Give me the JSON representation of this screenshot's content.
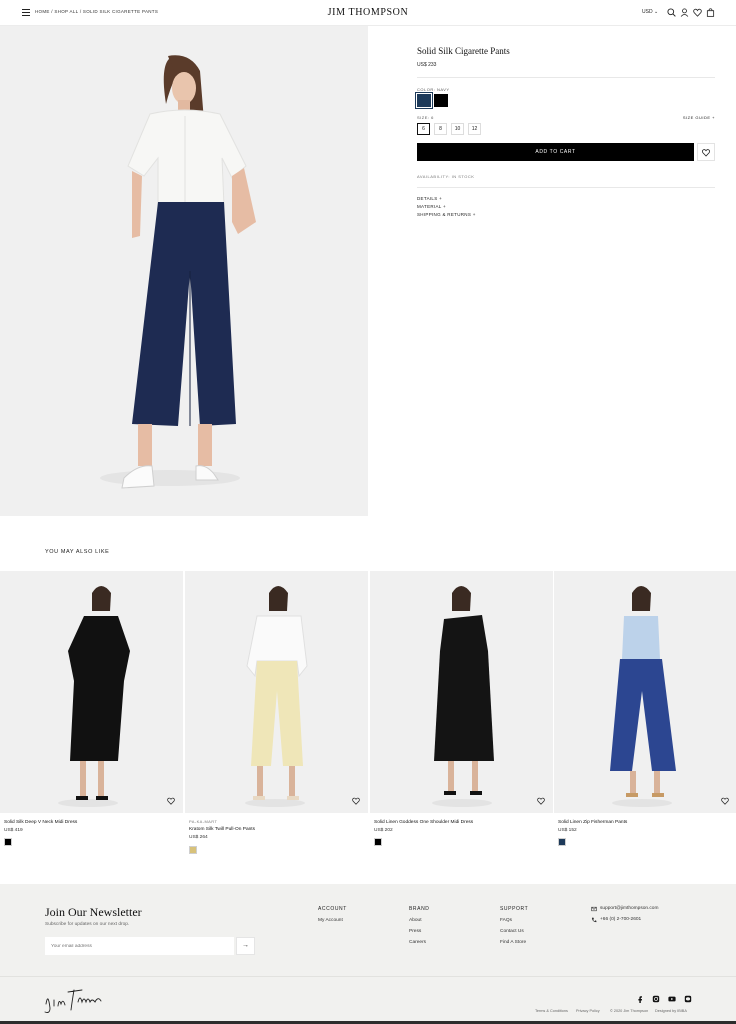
{
  "header": {
    "breadcrumb": "HOME / SHOP ALL / SOLID SILK CIGARETTE PANTS",
    "brand": "JIM THOMPSON",
    "currency": "USD",
    "icons": [
      "menu-icon",
      "search-icon",
      "account-icon",
      "wishlist-icon",
      "bag-icon"
    ]
  },
  "product": {
    "title": "Solid Silk Cigarette Pants",
    "price": "US$ 233",
    "color_label": "COLOR: NAVY",
    "colors": [
      "#1d3a5a",
      "#000000"
    ],
    "size_label": "SIZE: 6",
    "sizes": [
      "6",
      "8",
      "10",
      "12"
    ],
    "size_guide": "SIZE GUIDE +",
    "add_to_cart": "ADD TO CART",
    "availability": "AVAILABILITY: IN STOCK",
    "accordion": [
      "DETAILS +",
      "MATERIAL +",
      "SHIPPING & RETURNS +"
    ]
  },
  "recommendations": {
    "title": "YOU MAY ALSO LIKE",
    "items": [
      {
        "label": "",
        "name": "Solid Silk Deep V Neck Midi Dress",
        "price": "US$ 419",
        "swatch": "#000000"
      },
      {
        "label": "PA-KA-MART",
        "name": "Kratom Silk Twill Pull-On Pants",
        "price": "US$ 264",
        "swatch": "#d8c27a"
      },
      {
        "label": "",
        "name": "Solid Linen Goddess One Shoulder Midi Dress",
        "price": "US$ 202",
        "swatch": "#000000"
      },
      {
        "label": "",
        "name": "Solid Linen Zip Fisherman Pants",
        "price": "US$ 152",
        "swatch": "#1d3a5a"
      }
    ]
  },
  "footer": {
    "newsletter_title": "Join Our Newsletter",
    "newsletter_sub": "Subscribe for updates on our next drop.",
    "email_placeholder": "Your email address",
    "submit_arrow": "→",
    "columns": [
      {
        "title": "ACCOUNT",
        "links": [
          "My Account"
        ]
      },
      {
        "title": "BRAND",
        "links": [
          "About",
          "Press",
          "Careers"
        ]
      },
      {
        "title": "SUPPORT",
        "links": [
          "FAQs",
          "Contact Us",
          "Find A Store"
        ]
      }
    ],
    "email": "support@jimthompson.com",
    "phone": "+66 (0) 2-700-2601",
    "signature": "Jim Thompson",
    "legal": [
      "Terms & Conditions",
      "Privacy Policy",
      "© 2020 Jim Thompson",
      "Designed by IBIBA"
    ],
    "social": [
      "facebook-icon",
      "instagram-icon",
      "youtube-icon",
      "line-icon"
    ]
  },
  "colors": {
    "accent": "#000000",
    "navy": "#1d3a5a",
    "footer_bg": "#f1f1ef",
    "image_bg": "#f0f0f0"
  }
}
